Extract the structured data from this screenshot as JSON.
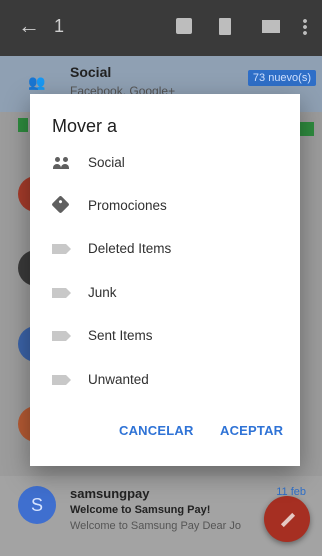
{
  "topbar": {
    "selected_count": "1"
  },
  "background_list": {
    "social_row": {
      "title": "Social",
      "subtitle": "Facebook, Google+",
      "badge": "73 nuevo(s)"
    },
    "bottom_row": {
      "avatar_letter": "S",
      "sender": "samsungpay",
      "subject": "Welcome to Samsung Pay!",
      "snippet": "Welcome to Samsung Pay Dear Jo",
      "date": "11 feb"
    }
  },
  "dialog": {
    "title": "Mover a",
    "options": [
      {
        "label": "Social",
        "icon": "people-icon"
      },
      {
        "label": "Promociones",
        "icon": "tag-icon"
      },
      {
        "label": "Deleted Items",
        "icon": "label-icon"
      },
      {
        "label": "Junk",
        "icon": "label-icon"
      },
      {
        "label": "Sent Items",
        "icon": "label-icon"
      },
      {
        "label": "Unwanted",
        "icon": "label-icon"
      }
    ],
    "cancel_label": "CANCELAR",
    "accept_label": "ACEPTAR"
  },
  "colors": {
    "accent": "#2f73d6",
    "fab": "#a62f22",
    "scrim_topbar": "#3a3a3a"
  }
}
